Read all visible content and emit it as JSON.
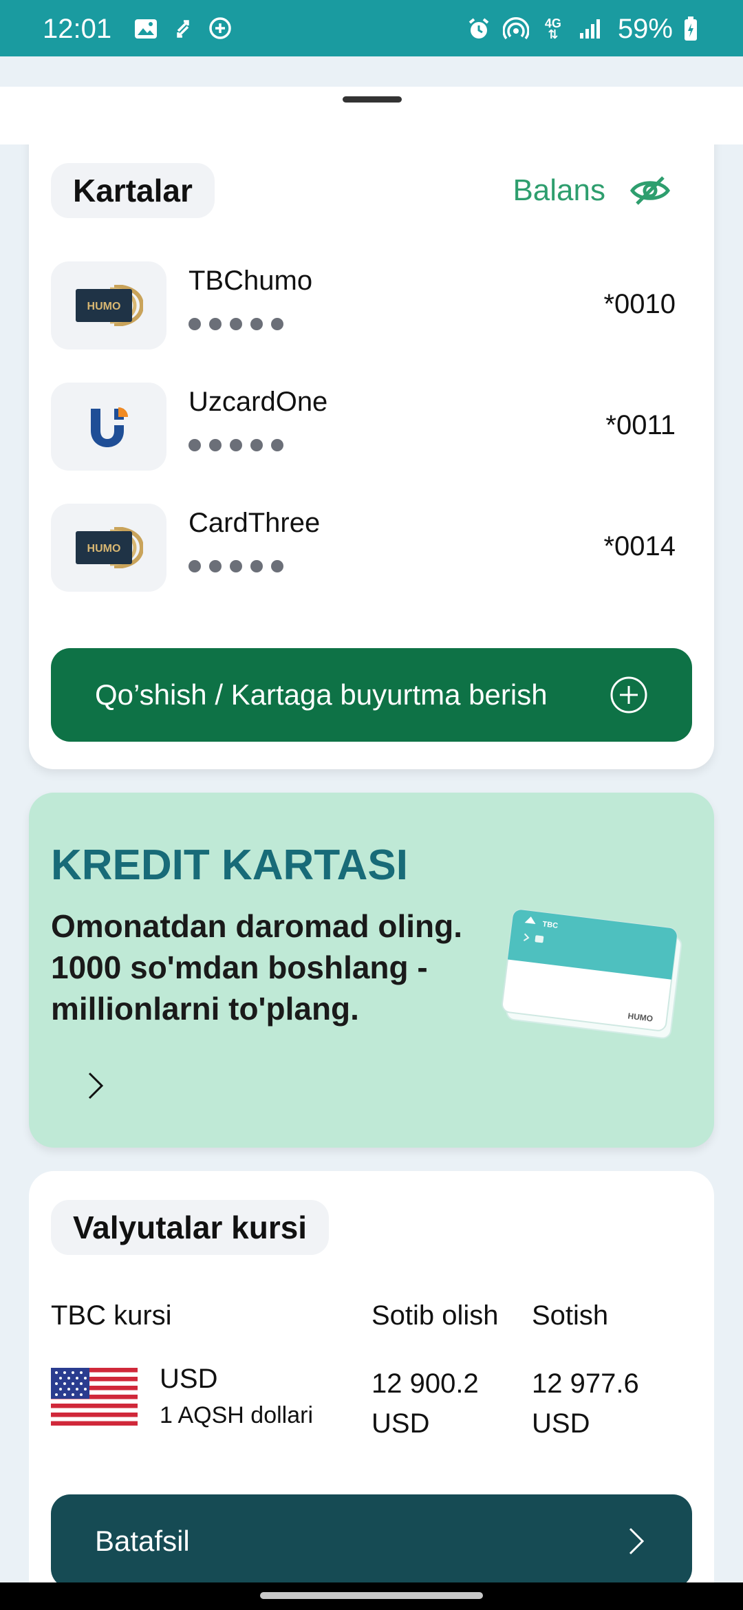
{
  "status_bar": {
    "time": "12:01",
    "battery": "59%",
    "network": "4G",
    "icons_left": [
      "image-icon",
      "transfer-icon",
      "add-circle-icon"
    ],
    "icons_right": [
      "alarm-icon",
      "hotspot-icon",
      "network-4g-icon",
      "signal-icon",
      "battery-icon"
    ]
  },
  "cards_section": {
    "title": "Kartalar",
    "balance_label": "Balans",
    "balance_icon": "eye-hidden-icon",
    "cards": [
      {
        "name": "TBChumo",
        "number": "*0010",
        "brand": "HUMO"
      },
      {
        "name": "UzcardOne",
        "number": "*0011",
        "brand": "Uzcard"
      },
      {
        "name": "CardThree",
        "number": "*0014",
        "brand": "HUMO"
      }
    ],
    "add_button_label": "Qo’shish / Kartaga buyurtma berish"
  },
  "promo": {
    "title": "KREDIT KARTASI",
    "lines": [
      "Omonatdan daromad oling.",
      "1000 so'mdan boshlang -",
      "millionlarni to'plang."
    ],
    "card_bank_label": "TBC",
    "card_brand_label": "HUMO"
  },
  "currency": {
    "title": "Valyutalar kursi",
    "headers": {
      "rate": "TBC kursi",
      "buy": "Sotib olish",
      "sell": "Sotish"
    },
    "rows": [
      {
        "code": "USD",
        "name": "1 AQSH dollari",
        "buy": "12 900.2",
        "buy_unit": "USD",
        "sell": "12 977.6",
        "sell_unit": "USD"
      }
    ],
    "more_button_label": "Batafsil"
  },
  "colors": {
    "status_bar": "#1a9ba0",
    "primary_green": "#0e7246",
    "balance_green": "#2e9e6e",
    "promo_bg": "#bfe9d6",
    "promo_title": "#186b78",
    "dark_teal_button": "#164b54"
  }
}
